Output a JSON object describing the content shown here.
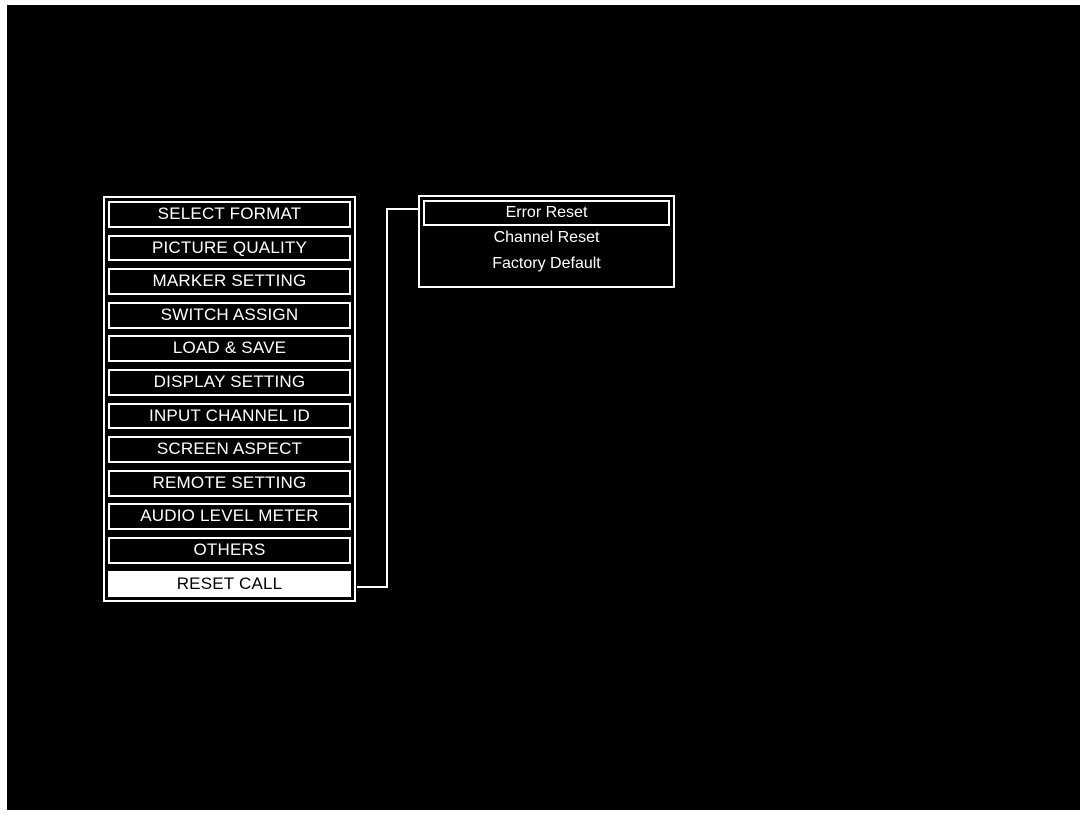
{
  "main_menu": {
    "items": [
      {
        "label": "SELECT FORMAT"
      },
      {
        "label": "PICTURE QUALITY"
      },
      {
        "label": "MARKER SETTING"
      },
      {
        "label": "SWITCH ASSIGN"
      },
      {
        "label": "LOAD & SAVE"
      },
      {
        "label": "DISPLAY SETTING"
      },
      {
        "label": "INPUT CHANNEL ID"
      },
      {
        "label": "SCREEN ASPECT"
      },
      {
        "label": "REMOTE SETTING"
      },
      {
        "label": "AUDIO LEVEL METER"
      },
      {
        "label": "OTHERS"
      },
      {
        "label": "RESET CALL",
        "selected": true
      }
    ]
  },
  "submenu": {
    "items": [
      {
        "label": "Error Reset",
        "selected": true
      },
      {
        "label": "Channel Reset"
      },
      {
        "label": "Factory Default"
      }
    ]
  },
  "colors": {
    "background": "#000000",
    "foreground": "#ffffff"
  }
}
